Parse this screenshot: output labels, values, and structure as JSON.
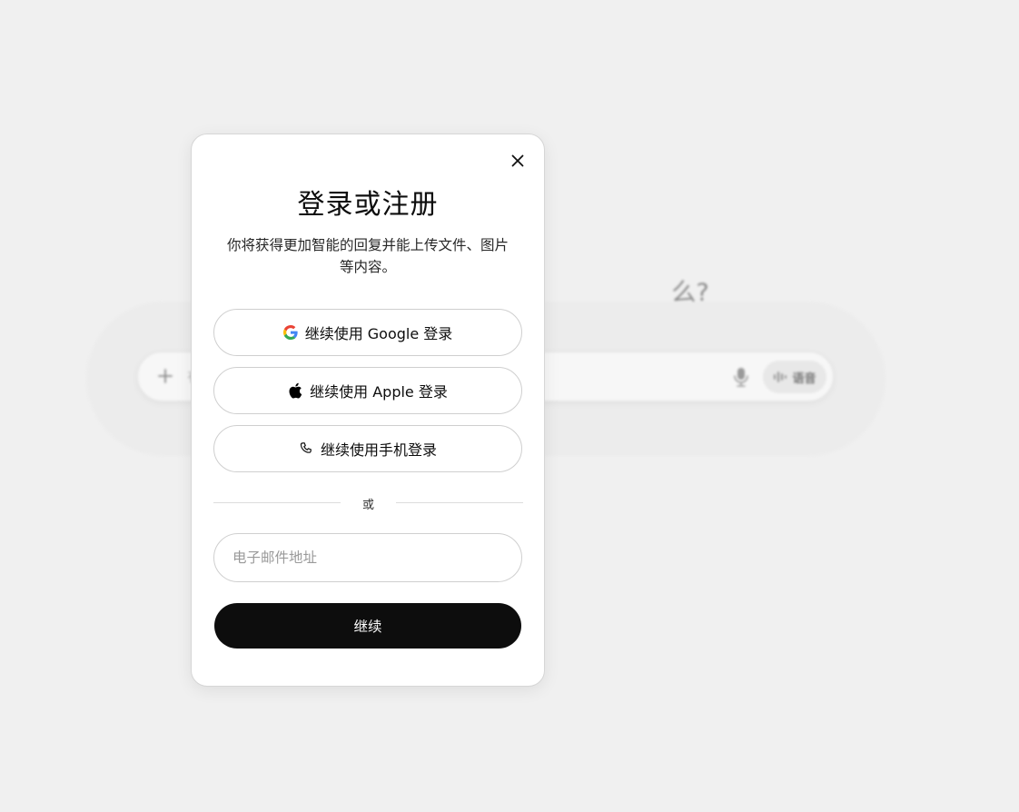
{
  "background": {
    "heading_visible_fragment": "么?",
    "composer": {
      "placeholder_fragment": "有",
      "voice_label": "语音"
    }
  },
  "modal": {
    "title": "登录或注册",
    "subtitle": "你将获得更加智能的回复并能上传文件、图片等内容。",
    "google_button": "继续使用 Google 登录",
    "apple_button": "继续使用 Apple 登录",
    "phone_button": "继续使用手机登录",
    "divider_text": "或",
    "email_placeholder": "电子邮件地址",
    "email_value": "",
    "continue_button": "继续"
  },
  "icons": {
    "close": "close-icon",
    "google": "google-icon",
    "apple": "apple-icon",
    "phone": "phone-icon",
    "plus": "plus-icon",
    "mic": "microphone-icon",
    "voice": "waveform-icon"
  },
  "colors": {
    "page_background": "#f0f0f0",
    "modal_background": "#ffffff",
    "primary_button": "#0d0d0d",
    "primary_button_text": "#ffffff",
    "border": "#cfcfcf"
  }
}
